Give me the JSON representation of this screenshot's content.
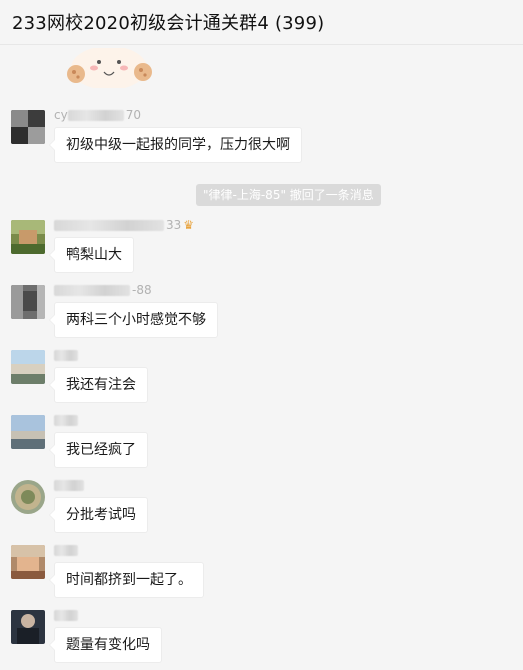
{
  "window": {
    "title": "233网校2020初级会计通关群4 (399)"
  },
  "system_notice": "\"律律-上海-85\" 撤回了一条消息",
  "messages": [
    {
      "nick": "cy",
      "nick_suffix": "70",
      "text": "初级中级一起报的同学，压力很大啊"
    },
    {
      "nick": "",
      "nick_suffix": "33",
      "text": "鸭梨山大"
    },
    {
      "nick": "",
      "nick_suffix": "-88",
      "text": "两科三个小时感觉不够"
    },
    {
      "nick": "",
      "nick_suffix": "",
      "text": "我还有注会"
    },
    {
      "nick": "",
      "nick_suffix": "",
      "text": "我已经疯了"
    },
    {
      "nick": "",
      "nick_suffix": "",
      "text": "分批考试吗"
    },
    {
      "nick": "",
      "nick_suffix": "",
      "text": "时间都挤到一起了。"
    },
    {
      "nick": "",
      "nick_suffix": "",
      "text": "题量有变化吗"
    }
  ],
  "icons": {
    "crown": "crown-icon",
    "sticker": "cartoon-sticker"
  }
}
